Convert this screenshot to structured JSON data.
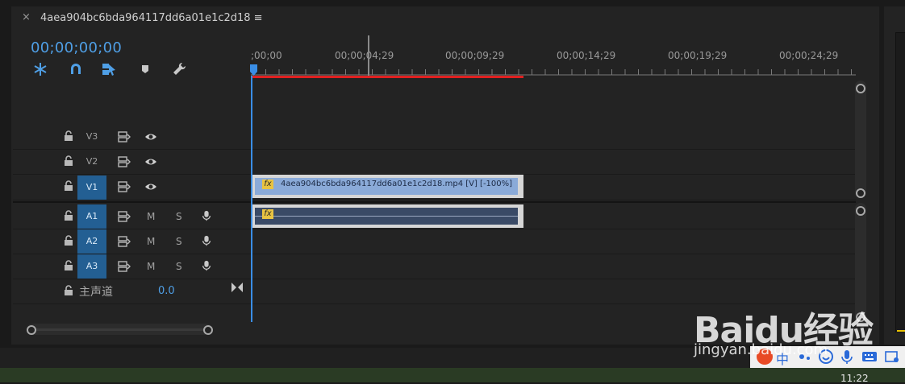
{
  "panel": {
    "tab_close": "×",
    "tab_title": "4aea904bc6bda964117dd6a01e1c2d18 ≡",
    "timecode": "00;00;00;00"
  },
  "toolbar": {
    "icons": [
      "snap-insert-icon",
      "magnet-icon",
      "linked-selection-icon",
      "add-marker-icon",
      "wrench-icon"
    ]
  },
  "ruler": {
    "ticks": [
      ";00;00",
      "00;00;04;29",
      "00;00;09;29",
      "00;00;14;29",
      "00;00;19;29",
      "00;00;24;29"
    ]
  },
  "tracks": {
    "v3": {
      "name": "V3"
    },
    "v2": {
      "name": "V2"
    },
    "v1": {
      "name": "V1"
    },
    "a1": {
      "name": "A1",
      "m": "M",
      "s": "S"
    },
    "a2": {
      "name": "A2",
      "m": "M",
      "s": "S"
    },
    "a3": {
      "name": "A3",
      "m": "M",
      "s": "S"
    },
    "master": {
      "label": "主声道",
      "value": "0.0"
    }
  },
  "clips": {
    "video_fx": "fx",
    "video_label": "4aea904bc6bda964117dd6a01e1c2d18.mp4 [V] [-100%]",
    "audio_fx": "fx"
  },
  "watermark": {
    "main": "Baidu经验",
    "sub": "jingyan.baidu.com"
  },
  "tray": {
    "ime": "中",
    "clock": "11:22",
    "icons": [
      "sogou-icon",
      "chinese-input-icon",
      "punctuation-icon",
      "emoji-icon",
      "mic-icon",
      "keyboard-icon",
      "settings-icon"
    ]
  },
  "colors": {
    "accent": "#4f9fe6",
    "track_active": "#235f93",
    "workarea": "#e02020",
    "video_clip": "#8aaad8",
    "audio_clip": "#3a4a66"
  }
}
